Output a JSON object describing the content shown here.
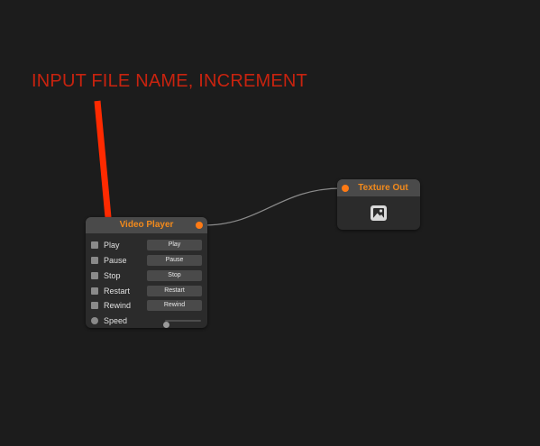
{
  "annotation": {
    "text": "INPUT FILE NAME, INCREMENT",
    "color": "#c8230f",
    "arrow_color": "#ff2a00"
  },
  "video_player": {
    "title": "Video Player",
    "rows": [
      {
        "label": "Play",
        "button": "Play"
      },
      {
        "label": "Pause",
        "button": "Pause"
      },
      {
        "label": "Stop",
        "button": "Stop"
      },
      {
        "label": "Restart",
        "button": "Restart"
      },
      {
        "label": "Rewind",
        "button": "Rewind"
      }
    ],
    "speed": {
      "label": "Speed",
      "value": 0
    }
  },
  "texture_out": {
    "title": "Texture Out",
    "icon": "image-icon"
  },
  "colors": {
    "background": "#1c1c1c",
    "node_body": "#2b2b2b",
    "node_header": "#4a4a4a",
    "title_accent": "#f28a1c",
    "port": "#ff7a14",
    "wire": "#8a8a8a"
  }
}
